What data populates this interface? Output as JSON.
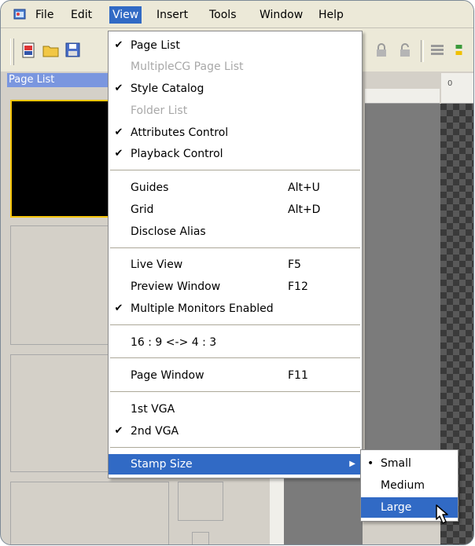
{
  "menubar": {
    "items": [
      {
        "label": "File",
        "active": false
      },
      {
        "label": "Edit",
        "active": false
      },
      {
        "label": "View",
        "active": true
      },
      {
        "label": "Insert",
        "active": false
      },
      {
        "label": "Tools",
        "active": false
      },
      {
        "label": "Window",
        "active": false
      },
      {
        "label": "Help",
        "active": false
      }
    ]
  },
  "left_panel": {
    "title": "Page List"
  },
  "ruler": {
    "zero_label": "0"
  },
  "view_menu": {
    "items": [
      {
        "label": "Page List",
        "checked": true,
        "disabled": false,
        "shortcut": ""
      },
      {
        "label": "MultipleCG Page List",
        "checked": false,
        "disabled": true,
        "shortcut": ""
      },
      {
        "label": "Style Catalog",
        "checked": true,
        "disabled": false,
        "shortcut": ""
      },
      {
        "label": "Folder List",
        "checked": false,
        "disabled": true,
        "shortcut": ""
      },
      {
        "label": "Attributes Control",
        "checked": true,
        "disabled": false,
        "shortcut": ""
      },
      {
        "label": "Playback Control",
        "checked": true,
        "disabled": false,
        "shortcut": ""
      },
      {
        "label": "Guides",
        "checked": false,
        "disabled": false,
        "shortcut": "Alt+U"
      },
      {
        "label": "Grid",
        "checked": false,
        "disabled": false,
        "shortcut": "Alt+D"
      },
      {
        "label": "Disclose Alias",
        "checked": false,
        "disabled": false,
        "shortcut": ""
      },
      {
        "label": "Live View",
        "checked": false,
        "disabled": false,
        "shortcut": "F5"
      },
      {
        "label": "Preview Window",
        "checked": false,
        "disabled": false,
        "shortcut": "F12"
      },
      {
        "label": "Multiple Monitors Enabled",
        "checked": true,
        "disabled": false,
        "shortcut": ""
      },
      {
        "label": "16 : 9 <-> 4 : 3",
        "checked": false,
        "disabled": false,
        "shortcut": ""
      },
      {
        "label": "Page Window",
        "checked": false,
        "disabled": false,
        "shortcut": "F11"
      },
      {
        "label": "1st VGA",
        "checked": false,
        "disabled": false,
        "shortcut": ""
      },
      {
        "label": "2nd VGA",
        "checked": true,
        "disabled": false,
        "shortcut": ""
      },
      {
        "label": "Stamp Size",
        "checked": false,
        "disabled": false,
        "shortcut": "",
        "submenu": true,
        "highlighted": true
      }
    ],
    "check_glyph": "✔",
    "submenu_arrow": "▶"
  },
  "stamp_size_submenu": {
    "items": [
      {
        "label": "Small",
        "selected": true
      },
      {
        "label": "Medium",
        "selected": false
      },
      {
        "label": "Large",
        "selected": false,
        "highlighted": true
      }
    ],
    "bullet_glyph": "•"
  },
  "colors": {
    "menu_highlight": "#316ac5",
    "title_bar_blue": "#7a96df",
    "selected_stamp_border": "#f7c500",
    "menubar_bg": "#ece9d8"
  }
}
